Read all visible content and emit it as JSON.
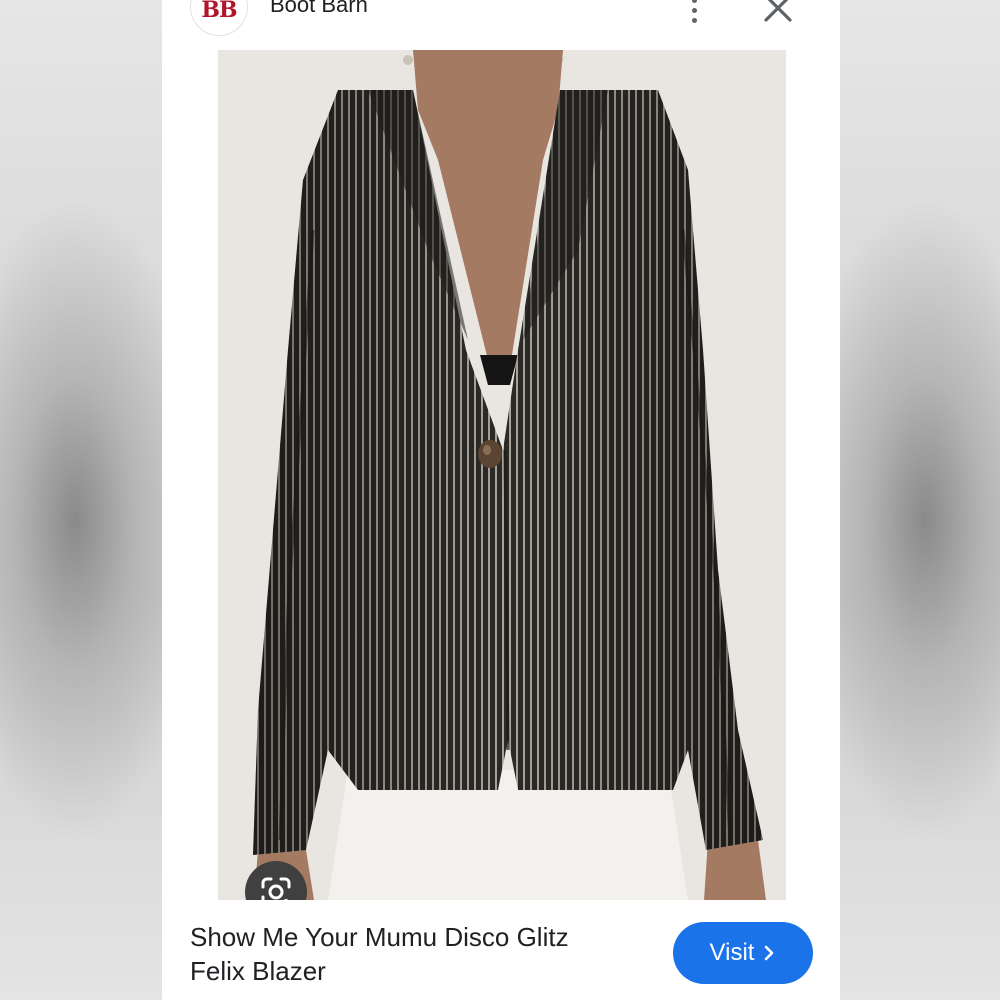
{
  "header": {
    "avatar_text": "BB",
    "brand": "Boot Barn",
    "more_icon": "more-vert-icon",
    "close_icon": "close-icon"
  },
  "image": {
    "description_icon": "product-photo",
    "lens_icon": "google-lens-icon"
  },
  "product": {
    "title_line1": "Show Me Your Mumu Disco Glitz",
    "title_line2": "Felix Blazer"
  },
  "actions": {
    "visit_label": "Visit",
    "visit_icon": "chevron-right-icon"
  },
  "colors": {
    "visit_button": "#1a73e8",
    "brand_red": "#b0152b",
    "lens_button": "#404040"
  }
}
